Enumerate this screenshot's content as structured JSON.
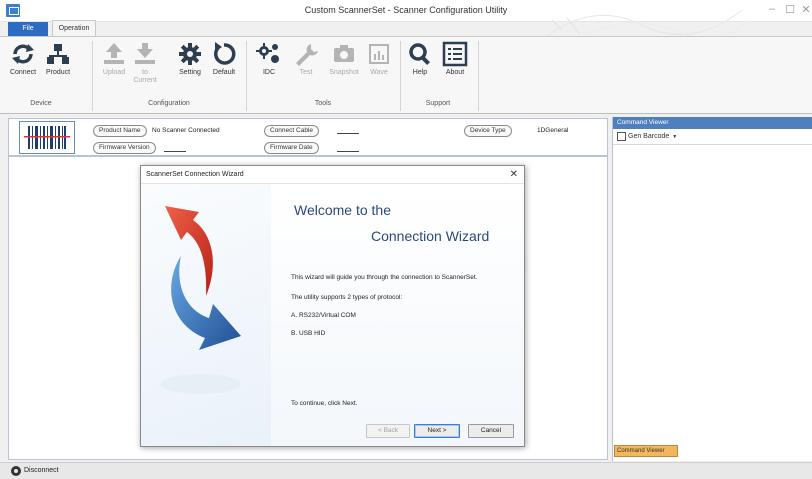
{
  "window": {
    "title": "Custom ScannerSet - Scanner Configuration Utility",
    "controls": [
      "–",
      "☐",
      "✕"
    ]
  },
  "ribbon": {
    "tabs": {
      "file": "File",
      "operation": "Operation"
    },
    "groups": {
      "device": "Device",
      "configuration": "Configuration",
      "tools": "Tools",
      "support": "Support"
    },
    "buttons": {
      "connect": "Connect",
      "product": "Product",
      "upload": "Upload",
      "to_current": "to Current",
      "setting": "Setting",
      "default": "Default",
      "idc": "IDC",
      "test": "Test",
      "snapshot": "Snapshot",
      "wave": "Wave",
      "help": "Help",
      "about": "About"
    }
  },
  "info": {
    "product_name_label": "Product Name",
    "product_name_value": "No Scanner Connected",
    "connect_cable_label": "Connect Cable",
    "device_type_label": "Device Type",
    "device_type_value": "1DGeneral",
    "firmware_version_label": "Firmware Version",
    "firmware_date_label": "Firmware Date"
  },
  "command_viewer": {
    "header": "Command Viewer",
    "gen_barcode": "Gen Barcode",
    "tab": "Command Viewer"
  },
  "status": {
    "disconnect": "Disconnect"
  },
  "dialog": {
    "title": "ScannerSet Connection Wizard",
    "close": "✕",
    "welcome_line1": "Welcome to the",
    "welcome_line2": "Connection Wizard",
    "line1": "This wizard will guide you through the connection to ScannerSet.",
    "line2": "The utility supports 2 types of protocol:",
    "opt_a": "A. RS232/Virtual COM",
    "opt_b": "B. USB HID",
    "footer": "To continue, click Next.",
    "back": "< Back",
    "next": "Next >",
    "cancel": "Cancel"
  },
  "colors": {
    "accent": "#2b6bc0",
    "arrow_red": "#d9392b",
    "arrow_blue": "#2f6fb6",
    "command_viewer_tab": "#f1b75a"
  }
}
